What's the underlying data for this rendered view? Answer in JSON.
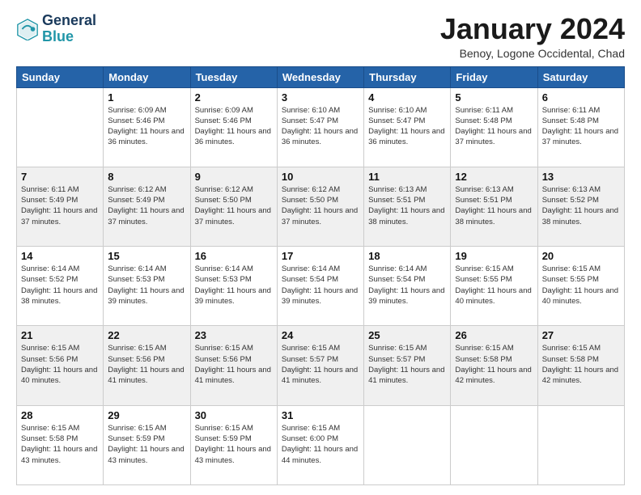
{
  "logo": {
    "line1": "General",
    "line2": "Blue",
    "icon_color": "#2196a8"
  },
  "header": {
    "month": "January 2024",
    "location": "Benoy, Logone Occidental, Chad"
  },
  "weekdays": [
    "Sunday",
    "Monday",
    "Tuesday",
    "Wednesday",
    "Thursday",
    "Friday",
    "Saturday"
  ],
  "weeks": [
    [
      {
        "day": "",
        "sunrise": "",
        "sunset": "",
        "daylight": ""
      },
      {
        "day": "1",
        "sunrise": "Sunrise: 6:09 AM",
        "sunset": "Sunset: 5:46 PM",
        "daylight": "Daylight: 11 hours and 36 minutes."
      },
      {
        "day": "2",
        "sunrise": "Sunrise: 6:09 AM",
        "sunset": "Sunset: 5:46 PM",
        "daylight": "Daylight: 11 hours and 36 minutes."
      },
      {
        "day": "3",
        "sunrise": "Sunrise: 6:10 AM",
        "sunset": "Sunset: 5:47 PM",
        "daylight": "Daylight: 11 hours and 36 minutes."
      },
      {
        "day": "4",
        "sunrise": "Sunrise: 6:10 AM",
        "sunset": "Sunset: 5:47 PM",
        "daylight": "Daylight: 11 hours and 36 minutes."
      },
      {
        "day": "5",
        "sunrise": "Sunrise: 6:11 AM",
        "sunset": "Sunset: 5:48 PM",
        "daylight": "Daylight: 11 hours and 37 minutes."
      },
      {
        "day": "6",
        "sunrise": "Sunrise: 6:11 AM",
        "sunset": "Sunset: 5:48 PM",
        "daylight": "Daylight: 11 hours and 37 minutes."
      }
    ],
    [
      {
        "day": "7",
        "sunrise": "Sunrise: 6:11 AM",
        "sunset": "Sunset: 5:49 PM",
        "daylight": "Daylight: 11 hours and 37 minutes."
      },
      {
        "day": "8",
        "sunrise": "Sunrise: 6:12 AM",
        "sunset": "Sunset: 5:49 PM",
        "daylight": "Daylight: 11 hours and 37 minutes."
      },
      {
        "day": "9",
        "sunrise": "Sunrise: 6:12 AM",
        "sunset": "Sunset: 5:50 PM",
        "daylight": "Daylight: 11 hours and 37 minutes."
      },
      {
        "day": "10",
        "sunrise": "Sunrise: 6:12 AM",
        "sunset": "Sunset: 5:50 PM",
        "daylight": "Daylight: 11 hours and 37 minutes."
      },
      {
        "day": "11",
        "sunrise": "Sunrise: 6:13 AM",
        "sunset": "Sunset: 5:51 PM",
        "daylight": "Daylight: 11 hours and 38 minutes."
      },
      {
        "day": "12",
        "sunrise": "Sunrise: 6:13 AM",
        "sunset": "Sunset: 5:51 PM",
        "daylight": "Daylight: 11 hours and 38 minutes."
      },
      {
        "day": "13",
        "sunrise": "Sunrise: 6:13 AM",
        "sunset": "Sunset: 5:52 PM",
        "daylight": "Daylight: 11 hours and 38 minutes."
      }
    ],
    [
      {
        "day": "14",
        "sunrise": "Sunrise: 6:14 AM",
        "sunset": "Sunset: 5:52 PM",
        "daylight": "Daylight: 11 hours and 38 minutes."
      },
      {
        "day": "15",
        "sunrise": "Sunrise: 6:14 AM",
        "sunset": "Sunset: 5:53 PM",
        "daylight": "Daylight: 11 hours and 39 minutes."
      },
      {
        "day": "16",
        "sunrise": "Sunrise: 6:14 AM",
        "sunset": "Sunset: 5:53 PM",
        "daylight": "Daylight: 11 hours and 39 minutes."
      },
      {
        "day": "17",
        "sunrise": "Sunrise: 6:14 AM",
        "sunset": "Sunset: 5:54 PM",
        "daylight": "Daylight: 11 hours and 39 minutes."
      },
      {
        "day": "18",
        "sunrise": "Sunrise: 6:14 AM",
        "sunset": "Sunset: 5:54 PM",
        "daylight": "Daylight: 11 hours and 39 minutes."
      },
      {
        "day": "19",
        "sunrise": "Sunrise: 6:15 AM",
        "sunset": "Sunset: 5:55 PM",
        "daylight": "Daylight: 11 hours and 40 minutes."
      },
      {
        "day": "20",
        "sunrise": "Sunrise: 6:15 AM",
        "sunset": "Sunset: 5:55 PM",
        "daylight": "Daylight: 11 hours and 40 minutes."
      }
    ],
    [
      {
        "day": "21",
        "sunrise": "Sunrise: 6:15 AM",
        "sunset": "Sunset: 5:56 PM",
        "daylight": "Daylight: 11 hours and 40 minutes."
      },
      {
        "day": "22",
        "sunrise": "Sunrise: 6:15 AM",
        "sunset": "Sunset: 5:56 PM",
        "daylight": "Daylight: 11 hours and 41 minutes."
      },
      {
        "day": "23",
        "sunrise": "Sunrise: 6:15 AM",
        "sunset": "Sunset: 5:56 PM",
        "daylight": "Daylight: 11 hours and 41 minutes."
      },
      {
        "day": "24",
        "sunrise": "Sunrise: 6:15 AM",
        "sunset": "Sunset: 5:57 PM",
        "daylight": "Daylight: 11 hours and 41 minutes."
      },
      {
        "day": "25",
        "sunrise": "Sunrise: 6:15 AM",
        "sunset": "Sunset: 5:57 PM",
        "daylight": "Daylight: 11 hours and 41 minutes."
      },
      {
        "day": "26",
        "sunrise": "Sunrise: 6:15 AM",
        "sunset": "Sunset: 5:58 PM",
        "daylight": "Daylight: 11 hours and 42 minutes."
      },
      {
        "day": "27",
        "sunrise": "Sunrise: 6:15 AM",
        "sunset": "Sunset: 5:58 PM",
        "daylight": "Daylight: 11 hours and 42 minutes."
      }
    ],
    [
      {
        "day": "28",
        "sunrise": "Sunrise: 6:15 AM",
        "sunset": "Sunset: 5:58 PM",
        "daylight": "Daylight: 11 hours and 43 minutes."
      },
      {
        "day": "29",
        "sunrise": "Sunrise: 6:15 AM",
        "sunset": "Sunset: 5:59 PM",
        "daylight": "Daylight: 11 hours and 43 minutes."
      },
      {
        "day": "30",
        "sunrise": "Sunrise: 6:15 AM",
        "sunset": "Sunset: 5:59 PM",
        "daylight": "Daylight: 11 hours and 43 minutes."
      },
      {
        "day": "31",
        "sunrise": "Sunrise: 6:15 AM",
        "sunset": "Sunset: 6:00 PM",
        "daylight": "Daylight: 11 hours and 44 minutes."
      },
      {
        "day": "",
        "sunrise": "",
        "sunset": "",
        "daylight": ""
      },
      {
        "day": "",
        "sunrise": "",
        "sunset": "",
        "daylight": ""
      },
      {
        "day": "",
        "sunrise": "",
        "sunset": "",
        "daylight": ""
      }
    ]
  ]
}
